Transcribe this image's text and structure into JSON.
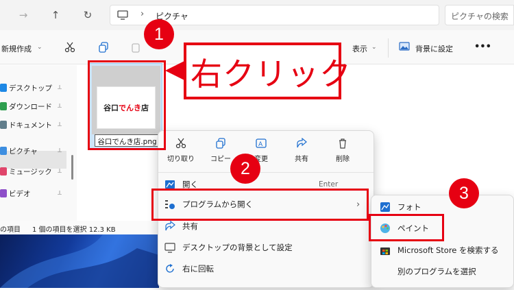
{
  "explorer": {
    "breadcrumb": "ピクチャ",
    "search_placeholder": "ピクチャの検索",
    "toolbar": {
      "new_label": "新規作成",
      "view_label": "表示",
      "set_background_label": "背景に設定",
      "more_label": "•••"
    },
    "sidebar": {
      "items": [
        {
          "label": "デスクトップ",
          "icon": "desktop-icon",
          "color": "#1e88e5"
        },
        {
          "label": "ダウンロード",
          "icon": "download-icon",
          "color": "#2e9e4f"
        },
        {
          "label": "ドキュメント",
          "icon": "document-icon",
          "color": "#607d8b"
        },
        {
          "label": "ピクチャ",
          "icon": "pictures-icon",
          "color": "#3d8ee0"
        },
        {
          "label": "ミュージック",
          "icon": "music-icon",
          "color": "#e0456b"
        },
        {
          "label": "ビデオ",
          "icon": "video-icon",
          "color": "#8e4fc9"
        }
      ]
    },
    "status": {
      "items_text": "の項目",
      "selected_text": "1 個の項目を選択 12.3 KB"
    },
    "file": {
      "name": "谷口でんき店.png",
      "thumb_text_black": "谷口",
      "thumb_text_red": "でんき",
      "thumb_text_black2": "店"
    }
  },
  "context_menu": {
    "quick_actions": [
      {
        "label": "切り取り",
        "icon": "scissors-icon"
      },
      {
        "label": "コピー",
        "icon": "copy-icon"
      },
      {
        "label": "変更",
        "icon": "rename-icon"
      },
      {
        "label": "共有",
        "icon": "share-icon"
      },
      {
        "label": "削除",
        "icon": "trash-icon"
      }
    ],
    "items": [
      {
        "label": "開く",
        "shortcut": "Enter",
        "icon": "open-icon"
      },
      {
        "label": "プログラムから開く",
        "icon": "open-with-icon",
        "has_submenu": true
      },
      {
        "label": "共有",
        "icon": "share-icon"
      },
      {
        "label": "デスクトップの背景として設定",
        "icon": "wallpaper-icon"
      },
      {
        "label": "右に回転",
        "icon": "rotate-right-icon"
      }
    ],
    "submenu": [
      {
        "label": "フォト",
        "icon": "photos-icon"
      },
      {
        "label": "ペイント",
        "icon": "paint-icon"
      },
      {
        "label": "Microsoft Store を検索する",
        "icon": "store-icon"
      },
      {
        "label": "別のプログラムを選択",
        "icon": ""
      }
    ]
  },
  "annotations": {
    "callout_text": "右クリック",
    "step1": "1",
    "step2": "2",
    "step3": "3",
    "accent_color": "#e60012"
  }
}
